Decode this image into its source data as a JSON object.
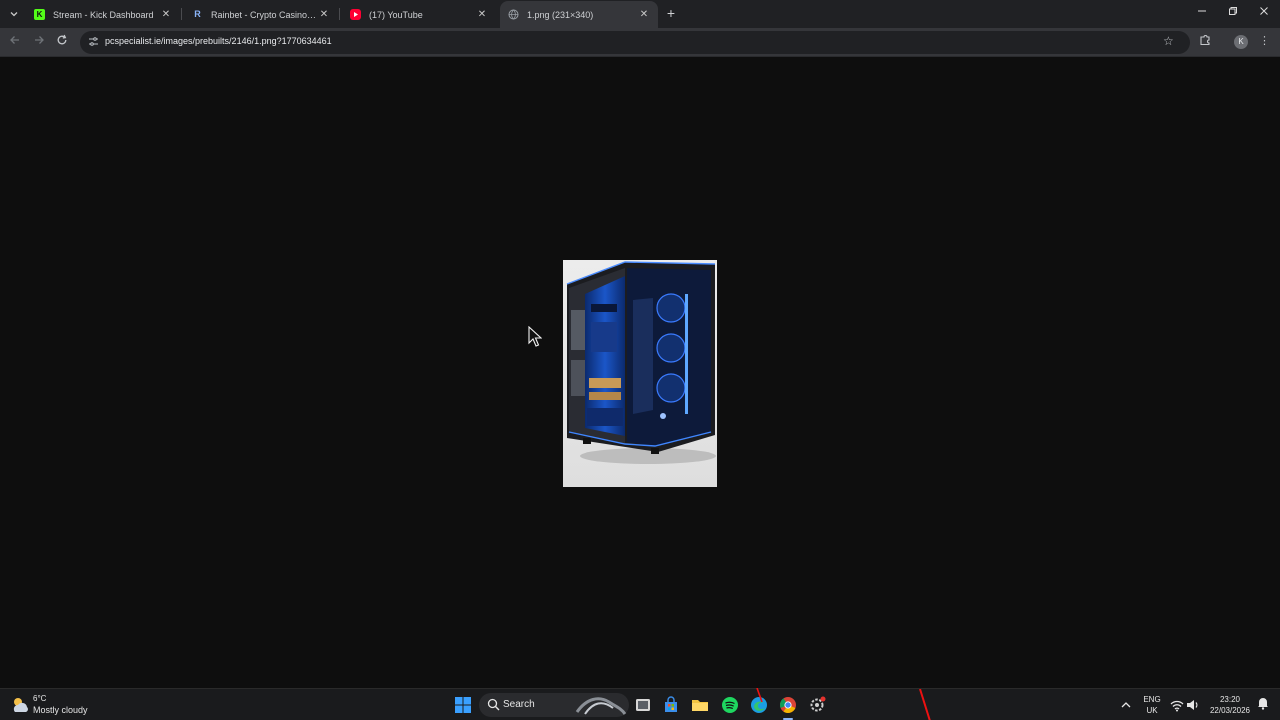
{
  "browser": {
    "tabs": [
      {
        "title": "Stream - Kick Dashboard",
        "favicon": "kick-icon",
        "color": "#53fc18",
        "active": false
      },
      {
        "title": "Rainbet - Crypto Casino & Sports",
        "favicon": "rainbet-icon",
        "color": "#8ab4f8",
        "active": false
      },
      {
        "title": "(17) YouTube",
        "favicon": "youtube-icon",
        "color": "#ff0033",
        "active": false
      },
      {
        "title": "1.png (231×340)",
        "favicon": "globe-icon",
        "color": "#9aa0a6",
        "active": true
      }
    ],
    "url": "pcspecialist.ie/images/prebuilts/2146/1.png?1770634461",
    "profile_initial": "K"
  },
  "viewer": {
    "image_alt": "PC tower case with blue lighting",
    "background": "#0e0e0e"
  },
  "taskbar": {
    "weather_temp": "6°C",
    "weather_desc": "Mostly cloudy",
    "search_label": "Search",
    "lang_top": "ENG",
    "lang_bottom": "UK",
    "time": "23:20",
    "date": "22/03/2026"
  }
}
